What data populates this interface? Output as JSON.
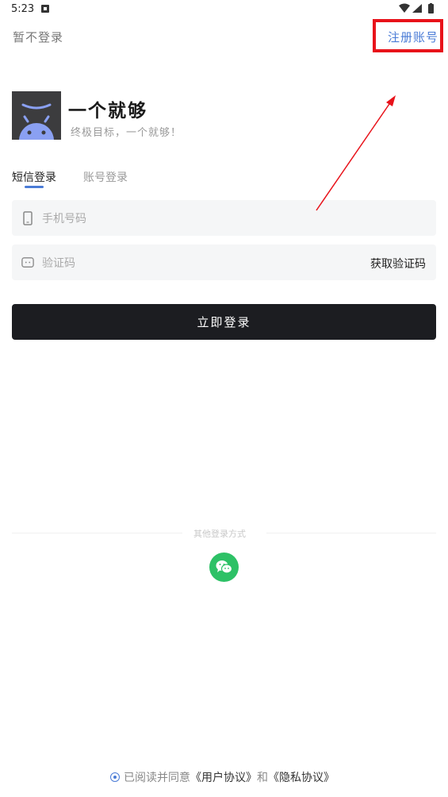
{
  "status_bar": {
    "time": "5:23"
  },
  "header": {
    "skip_label": "暂不登录",
    "register_label": "注册账号"
  },
  "app": {
    "name": "一个就够",
    "slogan": "终极目标，一个就够！"
  },
  "tabs": [
    {
      "label": "短信登录",
      "active": true
    },
    {
      "label": "账号登录",
      "active": false
    }
  ],
  "form": {
    "phone_placeholder": "手机号码",
    "code_placeholder": "验证码",
    "get_code_label": "获取验证码",
    "submit_label": "立即登录"
  },
  "other_login": {
    "label": "其他登录方式",
    "icon": "wechat-icon"
  },
  "agreement": {
    "checked": true,
    "prefix": "已阅读并同意",
    "user_agreement": "《用户协议》",
    "and": "和",
    "privacy_policy": "《隐私协议》"
  },
  "annotation": {
    "highlight_color": "#e8121a",
    "arrow_color": "#e8121a"
  },
  "colors": {
    "accent": "#4a7bd6",
    "button_bg": "#1c1d21",
    "wechat_green": "#2dc166",
    "logo_bg": "#3c3c3e",
    "android_robot": "#8aa0f2"
  }
}
